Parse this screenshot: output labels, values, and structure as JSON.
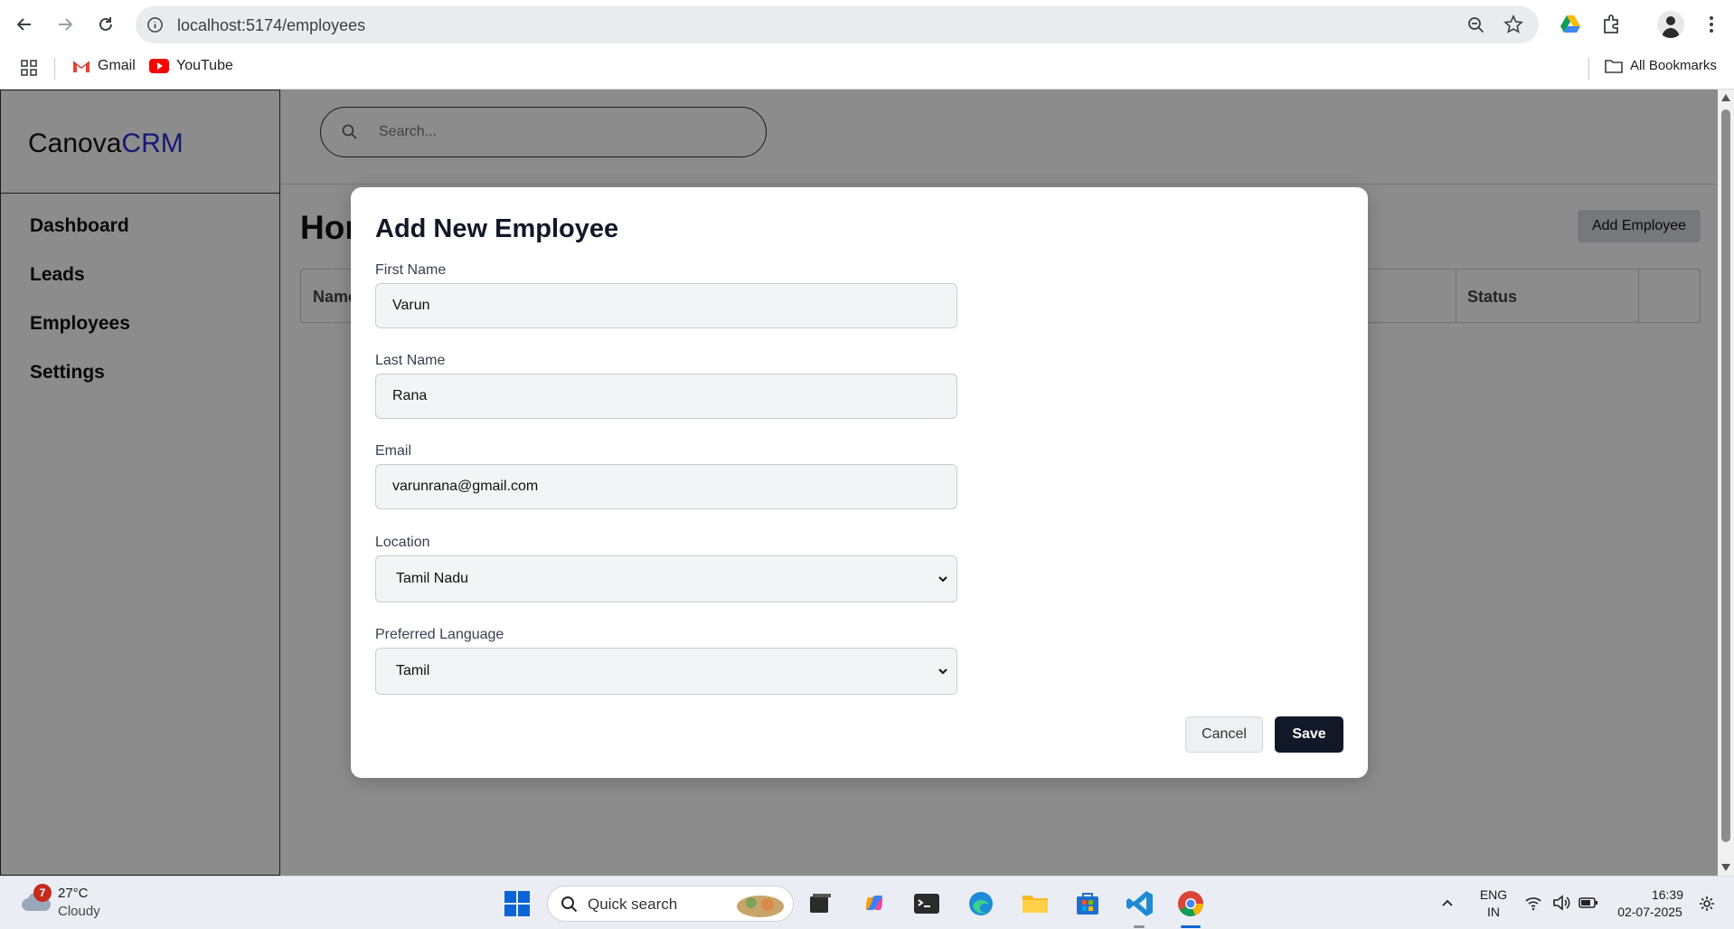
{
  "browser": {
    "url": "localhost:5174/employees",
    "bookmarks": [
      {
        "label": "Gmail",
        "icon": "gmail-icon"
      },
      {
        "label": "YouTube",
        "icon": "youtube-icon"
      }
    ],
    "all_bookmarks": "All Bookmarks"
  },
  "app": {
    "brand": {
      "part1": "Canova",
      "part2": "CRM"
    },
    "sidebar": {
      "items": [
        {
          "label": "Dashboard"
        },
        {
          "label": "Leads"
        },
        {
          "label": "Employees"
        },
        {
          "label": "Settings"
        }
      ]
    },
    "search": {
      "placeholder": "Search..."
    },
    "page_title": "Home > Employees",
    "add_button": "Add Employee",
    "table": {
      "columns": [
        "Name",
        "Status"
      ]
    }
  },
  "modal": {
    "title": "Add New Employee",
    "fields": {
      "first_name": {
        "label": "First Name",
        "value": "Varun"
      },
      "last_name": {
        "label": "Last Name",
        "value": "Rana"
      },
      "email": {
        "label": "Email",
        "value": "varunrana@gmail.com"
      },
      "location": {
        "label": "Location",
        "value": "Tamil Nadu"
      },
      "language": {
        "label": "Preferred Language",
        "value": "Tamil"
      }
    },
    "cancel_label": "Cancel",
    "save_label": "Save"
  },
  "taskbar": {
    "weather": {
      "badge": "7",
      "temp": "27°C",
      "desc": "Cloudy"
    },
    "search": "Quick search",
    "lang": {
      "line1": "ENG",
      "line2": "IN"
    },
    "time": "16:39",
    "date": "02-07-2025"
  }
}
